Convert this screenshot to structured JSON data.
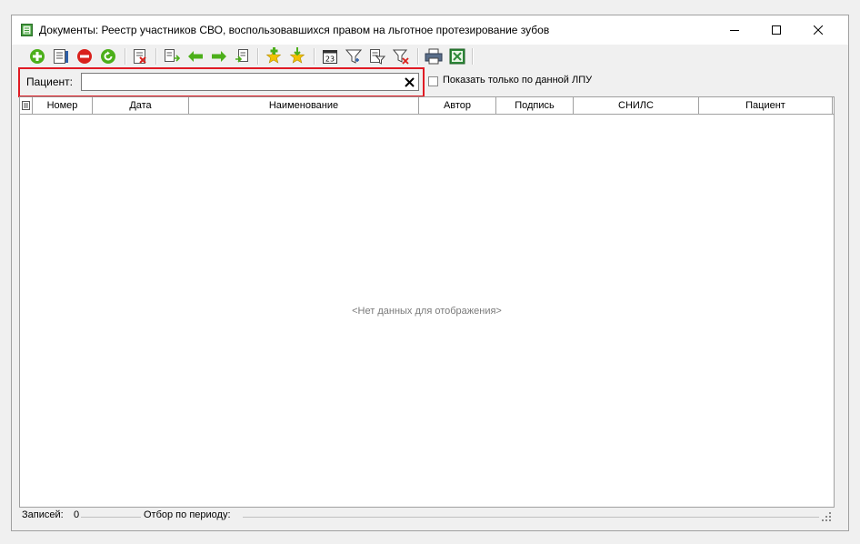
{
  "window": {
    "title": "Документы: Реестр участников СВО, воспользовавшихся правом на льготное протезирование зубов"
  },
  "titlebar_buttons": [
    "minimize-icon",
    "maximize-icon",
    "close-icon"
  ],
  "toolbar": {
    "icons": [
      "add-icon",
      "edit-document-icon",
      "delete-icon",
      "refresh-icon",
      "delete-document-icon",
      "copy-document-icon",
      "arrow-left-icon",
      "arrow-right-icon",
      "move-document-icon",
      "add-favorite-icon",
      "favorite-download-icon",
      "calendar-icon",
      "filter-icon",
      "filter-edit-icon",
      "filter-clear-icon",
      "print-icon",
      "excel-icon"
    ]
  },
  "filter": {
    "patient_label": "Пациент:",
    "patient_value": "",
    "show_only_lpu_label": "Показать только по данной ЛПУ",
    "show_only_lpu_checked": false
  },
  "grid": {
    "columns": [
      "Номер",
      "Дата",
      "Наименование",
      "Автор",
      "Подпись",
      "СНИЛС",
      "Пациент"
    ],
    "rows": [],
    "empty_text": "<Нет данных для отображения>"
  },
  "status": {
    "records_label": "Записей:",
    "records_count": "0",
    "period_label": "Отбор по периоду:"
  },
  "colors": {
    "highlight": "#e01b24",
    "green": "#4caf1a",
    "red": "#d9211c"
  }
}
